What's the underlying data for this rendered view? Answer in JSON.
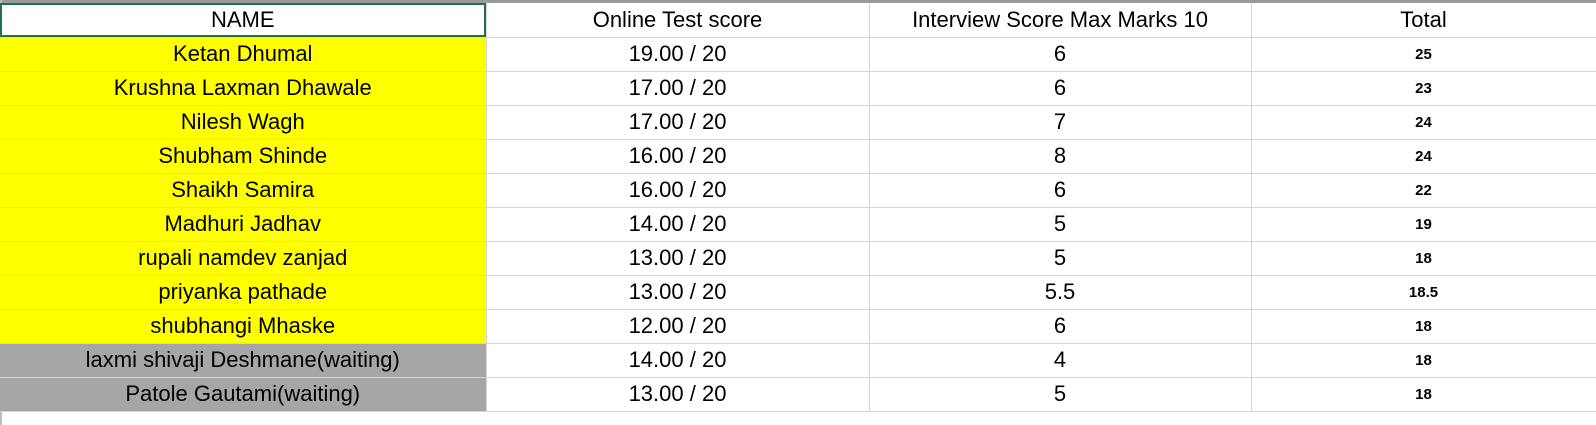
{
  "headers": {
    "name": "NAME",
    "online": "Online Test score",
    "interview": "Interview Score Max Marks 10",
    "total": "Total"
  },
  "colors": {
    "selected_highlight": "#ffff00",
    "waiting_highlight": "#a6a6a6",
    "active_cell_border": "#217346"
  },
  "rows": [
    {
      "name": "Ketan Dhumal",
      "online": "19.00 / 20",
      "interview": "6",
      "total": "25",
      "highlight": "yellow"
    },
    {
      "name": "Krushna Laxman Dhawale",
      "online": "17.00 / 20",
      "interview": "6",
      "total": "23",
      "highlight": "yellow"
    },
    {
      "name": "Nilesh Wagh",
      "online": "17.00 / 20",
      "interview": "7",
      "total": "24",
      "highlight": "yellow"
    },
    {
      "name": "Shubham Shinde",
      "online": "16.00 / 20",
      "interview": "8",
      "total": "24",
      "highlight": "yellow"
    },
    {
      "name": "Shaikh Samira",
      "online": "16.00 / 20",
      "interview": "6",
      "total": "22",
      "highlight": "yellow"
    },
    {
      "name": "Madhuri Jadhav",
      "online": "14.00 / 20",
      "interview": "5",
      "total": "19",
      "highlight": "yellow"
    },
    {
      "name": "rupali namdev zanjad",
      "online": "13.00 / 20",
      "interview": "5",
      "total": "18",
      "highlight": "yellow"
    },
    {
      "name": "priyanka pathade",
      "online": "13.00 / 20",
      "interview": "5.5",
      "total": "18.5",
      "highlight": "yellow"
    },
    {
      "name": "shubhangi Mhaske",
      "online": "12.00 / 20",
      "interview": "6",
      "total": "18",
      "highlight": "yellow"
    },
    {
      "name": "laxmi shivaji Deshmane(waiting)",
      "online": "14.00 / 20",
      "interview": "4",
      "total": "18",
      "highlight": "gray"
    },
    {
      "name": "Patole Gautami(waiting)",
      "online": "13.00 / 20",
      "interview": "5",
      "total": "18",
      "highlight": "gray"
    }
  ]
}
